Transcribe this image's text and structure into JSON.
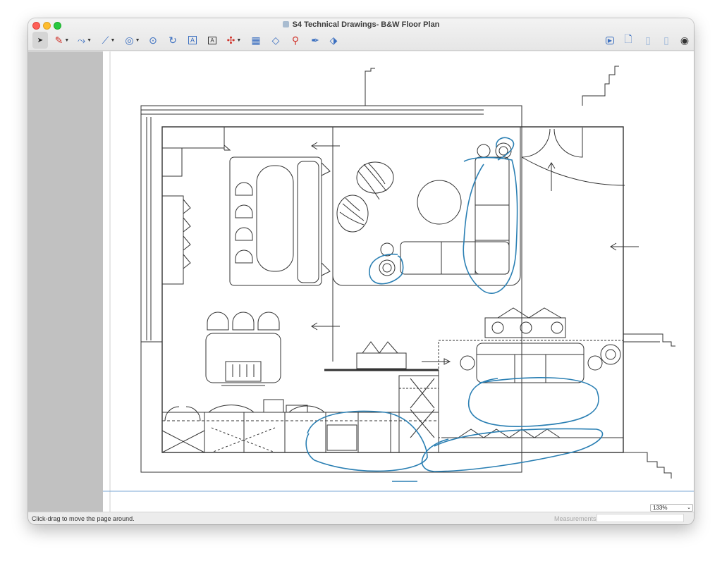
{
  "window": {
    "title": "S4 Technical Drawings- B&W Floor Plan"
  },
  "toolbar": {
    "tools": [
      {
        "name": "select-tool",
        "glyph": "➤"
      },
      {
        "name": "pen-tool",
        "glyph": "✎"
      },
      {
        "name": "bezier-tool",
        "glyph": "⌇"
      },
      {
        "name": "line-tool",
        "glyph": "⟋"
      },
      {
        "name": "circle-tool",
        "glyph": "◎"
      },
      {
        "name": "arc-tool",
        "glyph": "⟳"
      },
      {
        "name": "curve-tool",
        "glyph": "↻"
      },
      {
        "name": "text-tool",
        "glyph": "A"
      },
      {
        "name": "label-tool",
        "glyph": "A"
      },
      {
        "name": "node-tool",
        "glyph": "✣"
      },
      {
        "name": "table-tool",
        "glyph": "▦"
      },
      {
        "name": "eraser-tool",
        "glyph": "⌫"
      },
      {
        "name": "eyedropper-tool",
        "glyph": "⚲"
      },
      {
        "name": "fill-tool",
        "glyph": "✒"
      },
      {
        "name": "stamp-tool",
        "glyph": "⬦"
      }
    ],
    "right_tools": [
      {
        "name": "present-icon"
      },
      {
        "name": "add-page-icon"
      },
      {
        "name": "document-icon"
      },
      {
        "name": "document-alt-icon"
      },
      {
        "name": "account-icon"
      }
    ]
  },
  "statusbar": {
    "hint": "Click-drag to move the page around.",
    "measurements_label": "Measurements",
    "measurements_value": ""
  },
  "zoom": {
    "value": "133%"
  },
  "colors": {
    "accent": "#3b6fc0",
    "annotation": "#2a7fb3",
    "margin_guide": "#7aa7d6"
  }
}
